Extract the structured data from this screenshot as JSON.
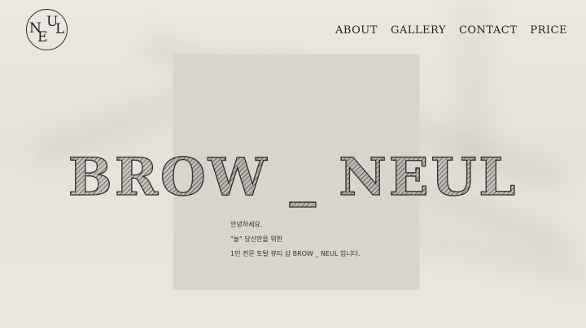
{
  "brand": {
    "logo_letters": [
      "N",
      "E",
      "U",
      "L"
    ]
  },
  "nav": {
    "items": [
      {
        "label": "ABOUT"
      },
      {
        "label": "GALLERY"
      },
      {
        "label": "CONTACT"
      },
      {
        "label": "PRICE"
      }
    ]
  },
  "hero": {
    "title": "BROW _ NEUL"
  },
  "intro": {
    "lines": [
      "안녕하세요.",
      "\"늘\" 당신만을 위한",
      "1인 전문 토탈 뷰티 샵 BROW _ NEUL 입니다."
    ]
  },
  "colors": {
    "background": "#e7e2da",
    "panel": "#d9d5cd",
    "text": "#232323"
  }
}
